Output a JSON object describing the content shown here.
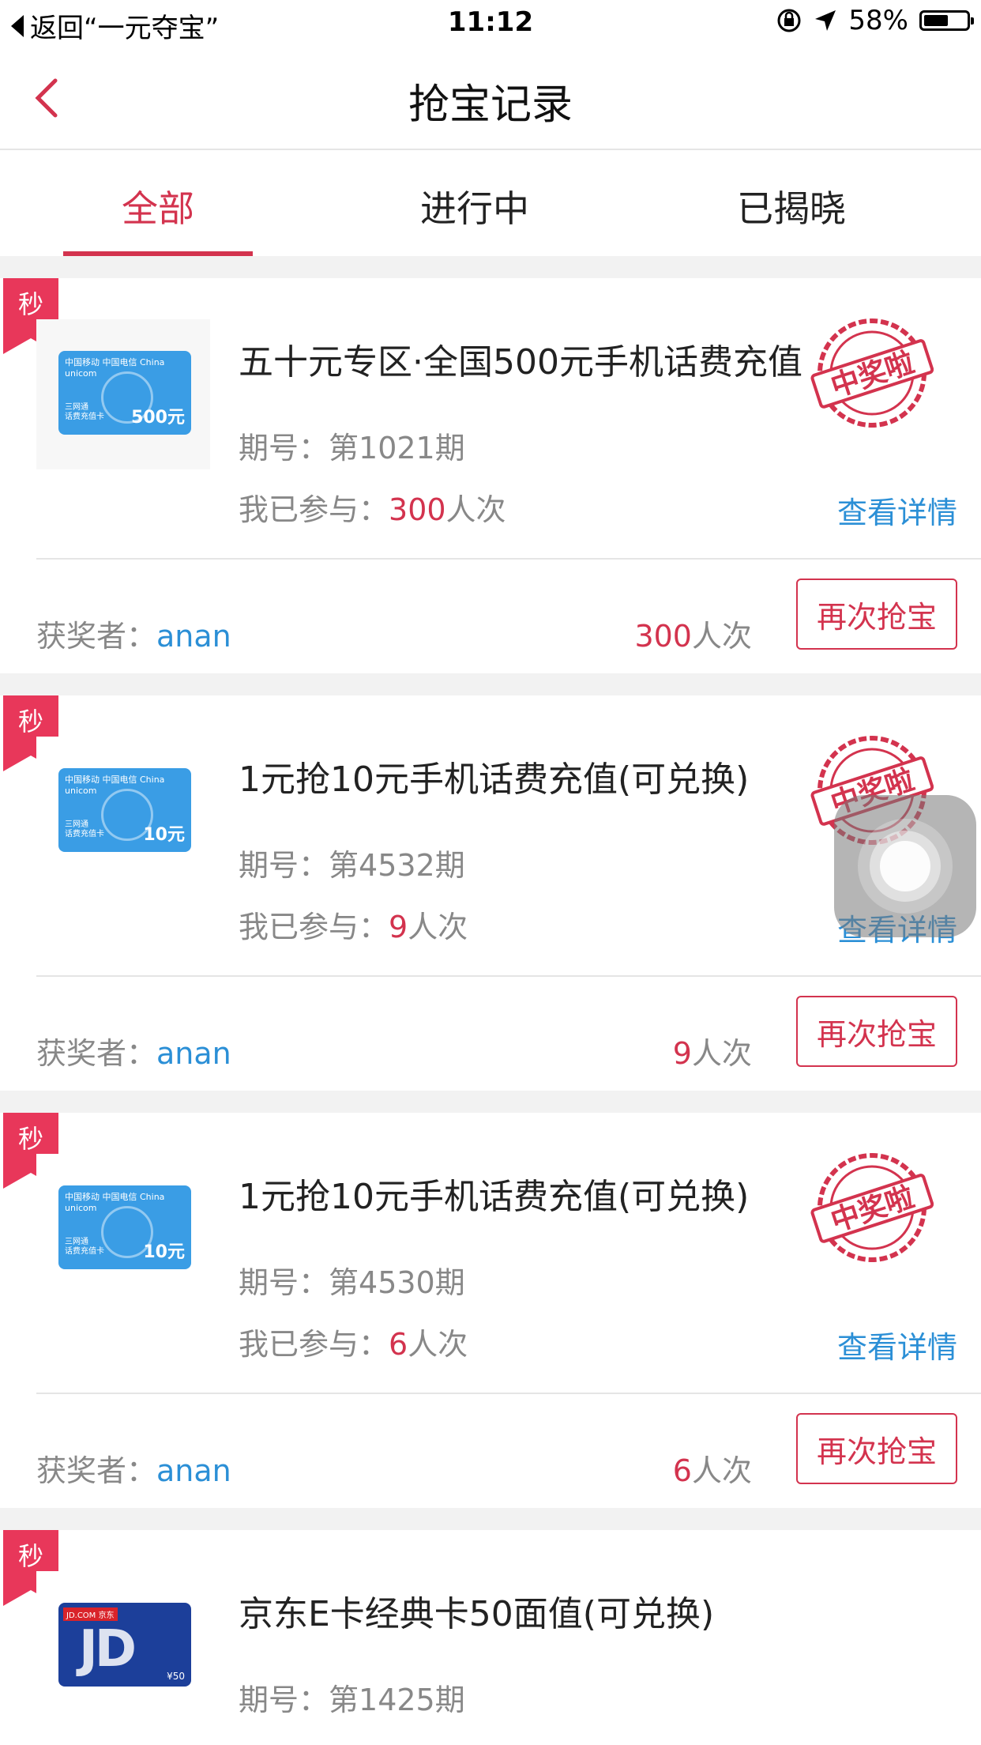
{
  "status": {
    "back_text": "返回“一元夺宝”",
    "time": "11:12",
    "battery": "58%",
    "battery_level": 0.58
  },
  "nav": {
    "title": "抢宝记录"
  },
  "tabs": [
    {
      "label": "全部",
      "active": true
    },
    {
      "label": "进行中",
      "active": false
    },
    {
      "label": "已揭晓",
      "active": false
    }
  ],
  "labels": {
    "sec": "秒",
    "period_prefix": "期号：",
    "joined_prefix": "我已参与：",
    "joined_suffix": "人次",
    "detail": "查看详情",
    "winner_prefix": "获奖者：",
    "count_suffix": "人次",
    "again": "再次抢宝",
    "stamp": "中奖啦"
  },
  "cards": [
    {
      "title": "五十元专区·全国500元手机话费充值",
      "period": "第1021期",
      "joined": "300",
      "winner": "anan",
      "count": "300",
      "card_amount": "500元"
    },
    {
      "title": "1元抢10元手机话费充值(可兑换)",
      "period": "第4532期",
      "joined": "9",
      "winner": "anan",
      "count": "9",
      "card_amount": "10元"
    },
    {
      "title": "1元抢10元手机话费充值(可兑换)",
      "period": "第4530期",
      "joined": "6",
      "winner": "anan",
      "count": "6",
      "card_amount": "10元"
    },
    {
      "title": "京东E卡经典卡50面值(可兑换)",
      "period": "第1425期",
      "card_amount": "¥50"
    }
  ],
  "colors": {
    "accent": "#d3334e",
    "link": "#2b8fd6",
    "badge": "#e8375a"
  }
}
